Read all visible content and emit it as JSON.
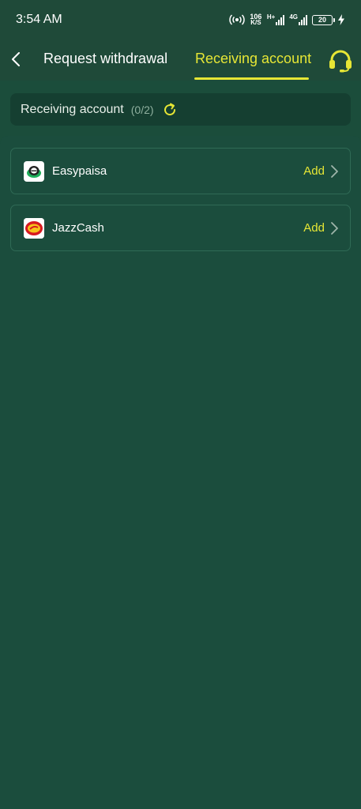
{
  "status_bar": {
    "time": "3:54 AM",
    "speed_value": "106",
    "speed_unit": "K/S",
    "net1_label": "H+",
    "net2_label": "4G",
    "battery": "20"
  },
  "header": {
    "tabs": [
      {
        "label": "Request withdrawal",
        "active": false
      },
      {
        "label": "Receiving account",
        "active": true
      }
    ]
  },
  "summary": {
    "title": "Receiving account",
    "count": "(0/2)"
  },
  "accounts": [
    {
      "name": "Easypaisa",
      "action": "Add"
    },
    {
      "name": "JazzCash",
      "action": "Add"
    }
  ],
  "colors": {
    "background": "#1b4d3b",
    "accent": "#e6e635"
  }
}
